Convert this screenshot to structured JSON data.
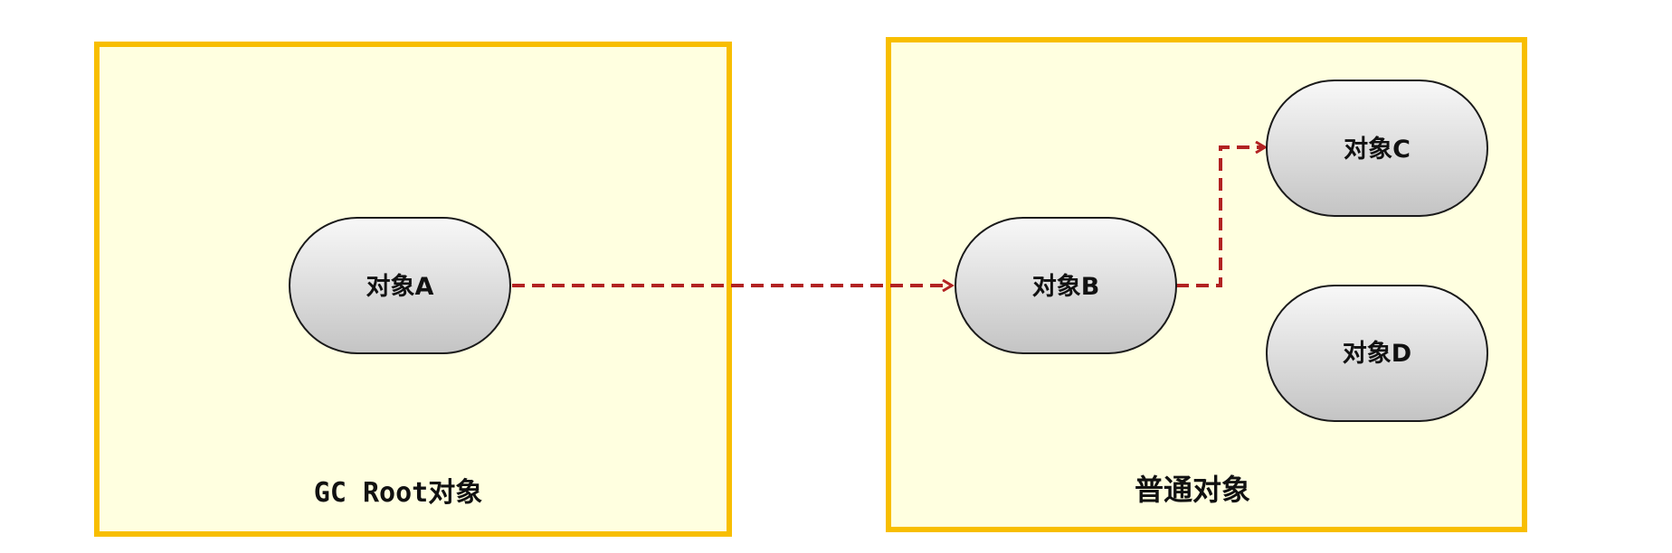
{
  "diagram": {
    "groups": {
      "gc_root": {
        "label": "GC Root对象"
      },
      "normal": {
        "label": "普通对象"
      }
    },
    "nodes": {
      "a": {
        "label": "对象A"
      },
      "b": {
        "label": "对象B"
      },
      "c": {
        "label": "对象C"
      },
      "d": {
        "label": "对象D"
      }
    },
    "edges": [
      {
        "from": "对象A",
        "to": "对象B",
        "style": "dashed"
      },
      {
        "from": "对象B",
        "to": "对象C",
        "style": "dashed"
      }
    ],
    "colors": {
      "group_border": "#F8BE00",
      "group_fill": "#FFFFE0",
      "node_fill_top": "#F7F7F7",
      "node_fill_bottom": "#C8C8C8",
      "edge": "#B22222"
    }
  }
}
